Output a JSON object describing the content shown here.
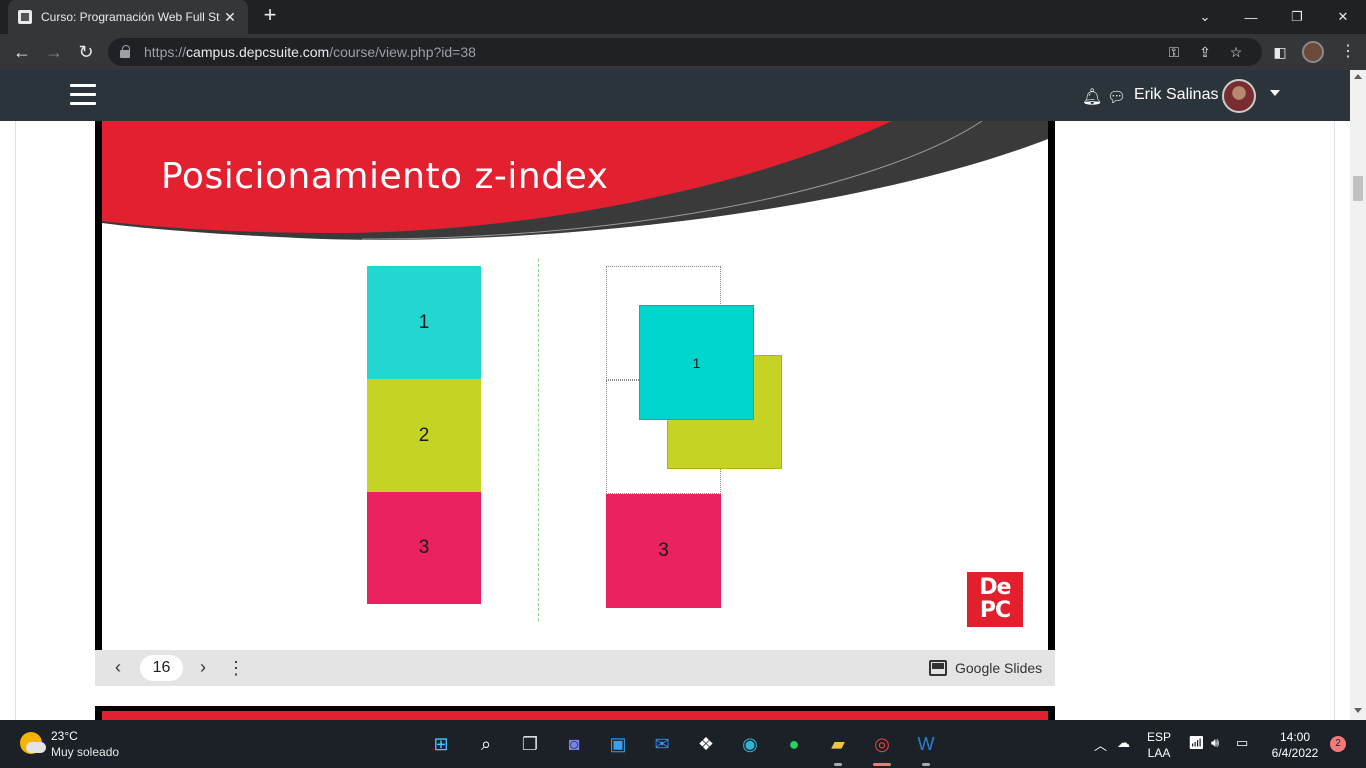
{
  "browser": {
    "tab_title": "Curso: Programación Web Full St",
    "url_prefix": "https://",
    "url_host": "campus.depcsuite.com",
    "url_path": "/course/view.php?id=38"
  },
  "moodle": {
    "username": "Erik Salinas"
  },
  "slide": {
    "title": "Posicionamiento z-index",
    "left_boxes": [
      {
        "label": "1",
        "color": "#23d7d1"
      },
      {
        "label": "2",
        "color": "#c5d424"
      },
      {
        "label": "3",
        "color": "#eb2260"
      }
    ],
    "right_boxes": [
      {
        "label": "1",
        "color": "#00d5cb"
      },
      {
        "label": "",
        "color": "#c5d424"
      },
      {
        "label": "3",
        "color": "#eb2260"
      }
    ],
    "logo_text_line1": "De",
    "logo_text_line2": "PC"
  },
  "slide_controls": {
    "page_number": "16",
    "brand": "Google Slides"
  },
  "taskbar": {
    "temperature": "23°C",
    "weather": "Muy soleado",
    "lang_line1": "ESP",
    "lang_line2": "LAA",
    "time": "14:00",
    "date": "6/4/2022",
    "notification_count": "2"
  },
  "colors": {
    "banner_red": "#e3202f",
    "banner_dark": "#3a3a3a",
    "moodle_nav": "#2b343b"
  }
}
